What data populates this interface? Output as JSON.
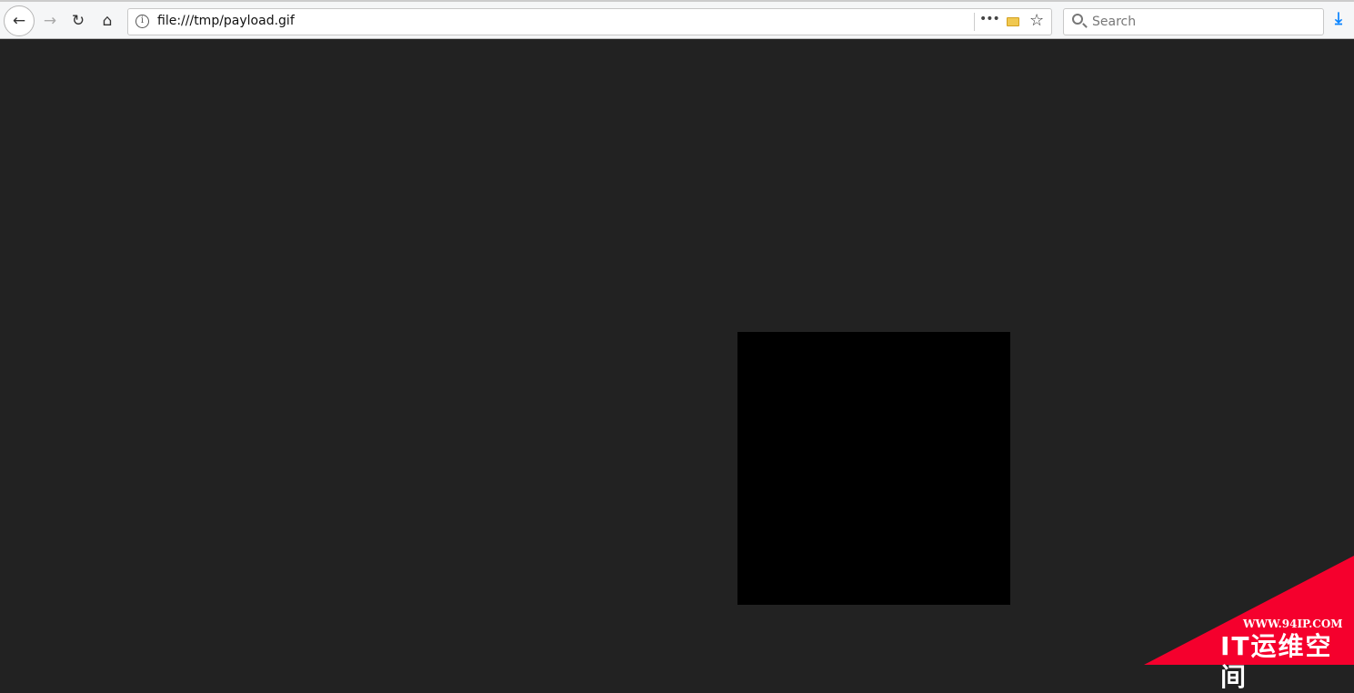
{
  "browser": {
    "url": "file:///tmp/payload.gif",
    "search_placeholder": "Search",
    "icons": [
      "back-icon",
      "forward-icon",
      "reload-icon",
      "home-icon",
      "info-icon",
      "more-icon",
      "folder-icon",
      "star-icon",
      "search-icon",
      "download-icon"
    ]
  },
  "watermark": {
    "site": "WWW.94IP.COM",
    "name": "IT运维空间",
    "color": "#f5002d"
  },
  "colors": {
    "page_bg": "#222222",
    "image": "#000000"
  }
}
